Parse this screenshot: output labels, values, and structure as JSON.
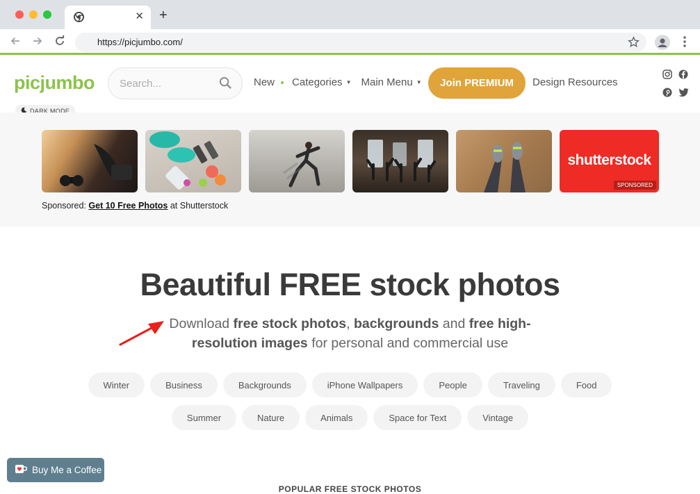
{
  "browser": {
    "url": "https://picjumbo.com/",
    "close_glyph": "✕",
    "new_tab_glyph": "+"
  },
  "site": {
    "logo": "picjumbo",
    "search_placeholder": "Search...",
    "nav": {
      "new": "New",
      "categories": "Categories",
      "main_menu": "Main Menu"
    },
    "premium_button": "Join PREMIUM",
    "design_resources": "Design Resources",
    "dark_mode": "DARK MODE"
  },
  "sponsored": {
    "shutter_logo": "shutterstock",
    "badge": "SPONSORED",
    "prefix": "Sponsored:",
    "link": "Get 10 Free Photos",
    "suffix": "at Shutterstock"
  },
  "hero": {
    "title": "Beautiful FREE stock photos",
    "sub": {
      "t1": "Download ",
      "b1": "free stock photos",
      "t2": ", ",
      "b2": "backgrounds",
      "t3": " and ",
      "b3": "free high-resolution images",
      "t4": " for personal and commercial use"
    }
  },
  "chips_row1": [
    "Winter",
    "Business",
    "Backgrounds",
    "iPhone Wallpapers",
    "People",
    "Traveling",
    "Food"
  ],
  "chips_row2": [
    "Summer",
    "Nature",
    "Animals",
    "Space for Text",
    "Vintage"
  ],
  "coffee_button": "Buy Me a Coffee",
  "popular_heading": "POPULAR FREE STOCK PHOTOS",
  "colors": {
    "brand_green": "#8bc34a",
    "premium_gold": "#e0a43a",
    "shutterstock_red": "#ee2b24",
    "arrow_red": "#e8201c"
  }
}
